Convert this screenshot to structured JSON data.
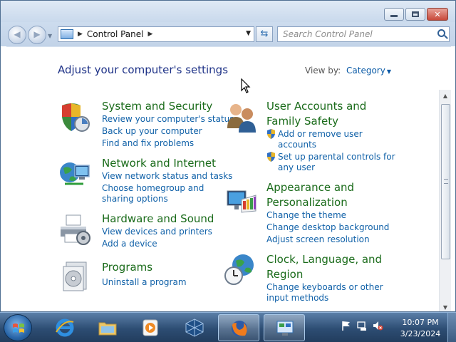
{
  "window": {
    "caption": {
      "minimize": "minimize",
      "maximize": "maximize",
      "close": "✕"
    }
  },
  "address": {
    "segment": "Control Panel",
    "search_placeholder": "Search Control Panel"
  },
  "content": {
    "heading": "Adjust your computer's settings",
    "view_by_label": "View by:",
    "view_by_value": "Category"
  },
  "categories": [
    {
      "title": "System and Security",
      "links": [
        "Review your computer's status",
        "Back up your computer",
        "Find and fix problems"
      ]
    },
    {
      "title": "Network and Internet",
      "links": [
        "View network status and tasks",
        "Choose homegroup and",
        "sharing options"
      ]
    },
    {
      "title": "Hardware and Sound",
      "links": [
        "View devices and printers",
        "Add a device"
      ]
    },
    {
      "title": "Programs",
      "links": [
        "Uninstall a program"
      ]
    },
    {
      "title_line1": "User Accounts and",
      "title_line2": "Family Safety",
      "links": [
        "Add or remove user",
        "accounts",
        "Set up parental controls for",
        "any user"
      ]
    },
    {
      "title_line1": "Appearance and",
      "title_line2": "Personalization",
      "links": [
        "Change the theme",
        "Change desktop background",
        "Adjust screen resolution"
      ]
    },
    {
      "title_line1": "Clock, Language, and",
      "title_line2": "Region",
      "links": [
        "Change keyboards or other",
        "input methods"
      ]
    }
  ],
  "taskbar": {
    "items": [
      "start-button",
      "internet-explorer",
      "windows-explorer",
      "media-player",
      "virtualbox",
      "firefox",
      "control-panel"
    ],
    "clock_time": "10:07 PM",
    "clock_date": "3/23/2024"
  },
  "colors": {
    "category_title": "#1a6b1a",
    "link": "#1061a8",
    "heading": "#1e3287"
  }
}
